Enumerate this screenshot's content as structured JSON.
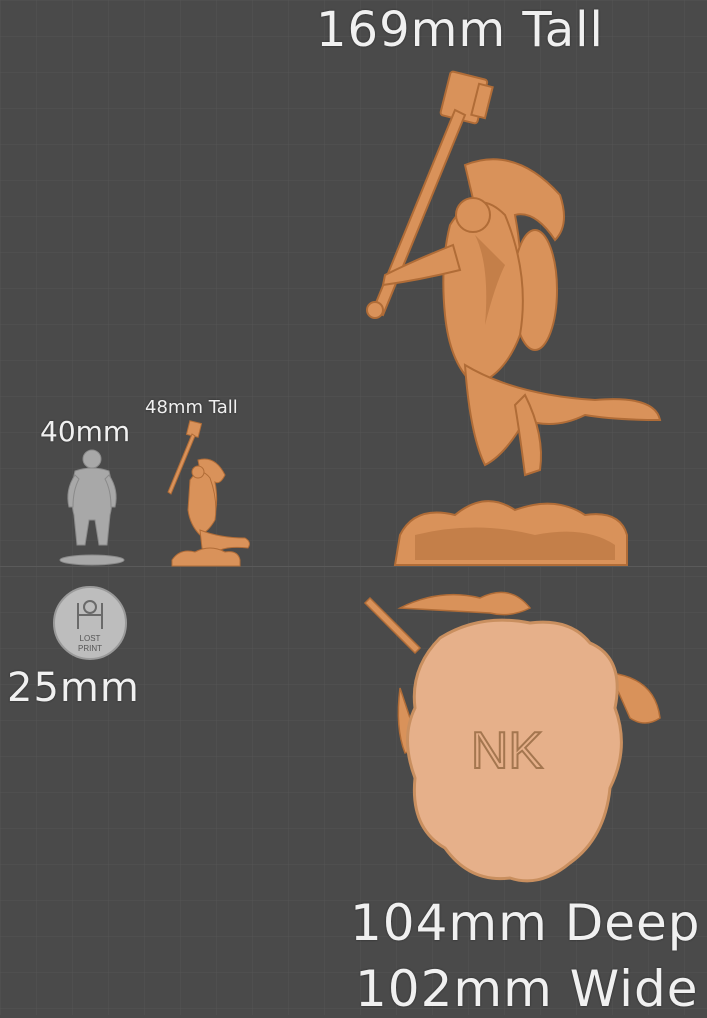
{
  "labels": {
    "height_large": "169mm Tall",
    "height_small": "48mm Tall",
    "reference_height": "40mm",
    "reference_base": "25mm",
    "depth": "104mm Deep",
    "width": "102mm Wide"
  },
  "logo": {
    "text_top": "LOST",
    "text_bottom": "PRINT"
  },
  "base_mark": "NK",
  "colors": {
    "background": "#4a4a4a",
    "grid": "#555555",
    "model": "#d9925a",
    "model_shadow": "#b06c37",
    "reference_model": "#a8a8a8",
    "base_top": "#e6b08a"
  }
}
